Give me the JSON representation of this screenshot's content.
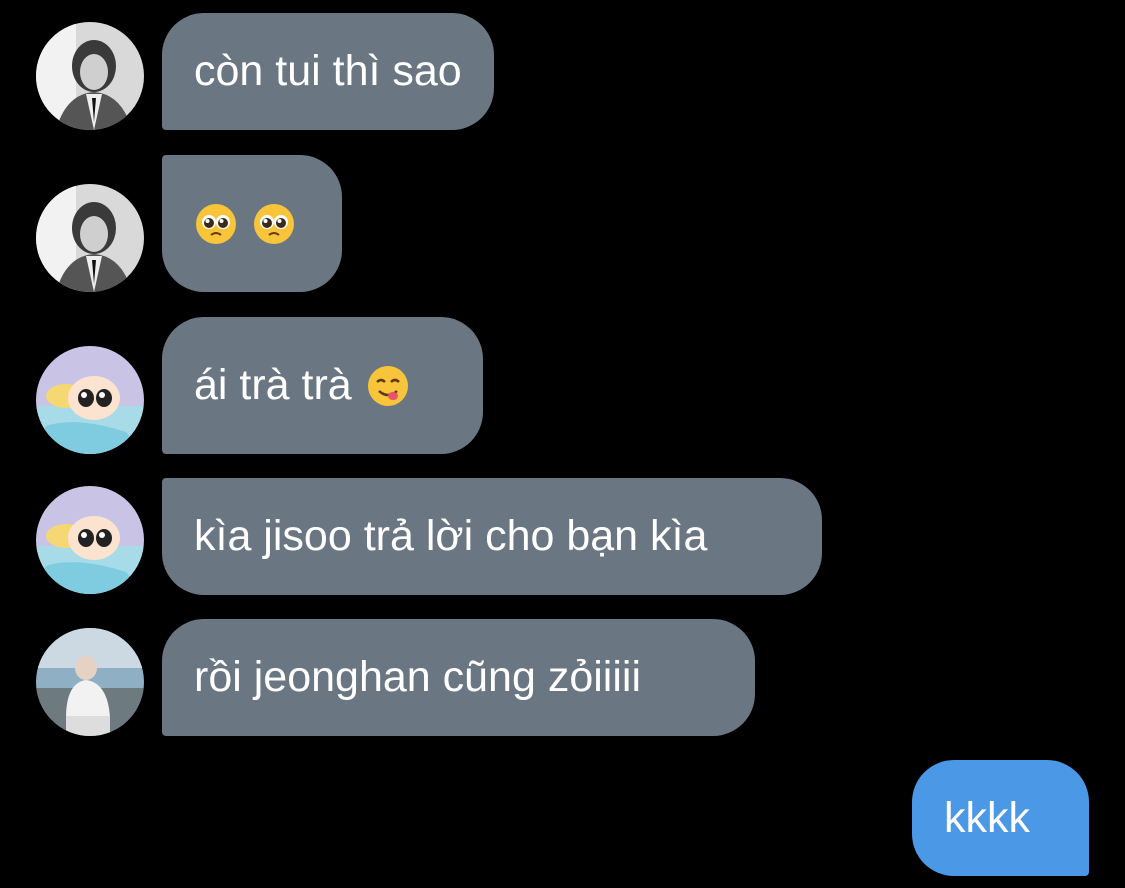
{
  "messages": [
    {
      "sender": "user-a",
      "text": "còn tui thì sao",
      "emojis": []
    },
    {
      "sender": "user-a",
      "text": "",
      "emojis": [
        "pleading-face",
        "pleading-face"
      ]
    },
    {
      "sender": "user-b",
      "text": "ái trà trà",
      "emojis": [
        "face-savoring-food"
      ]
    },
    {
      "sender": "user-b",
      "text": "kìa jisoo trả lời cho bạn kìa",
      "emojis": []
    },
    {
      "sender": "user-c",
      "text": "rồi jeonghan cũng zỏiiiii",
      "emojis": []
    },
    {
      "sender": "me",
      "text": "kkkk",
      "emojis": []
    }
  ],
  "colors": {
    "background": "#000000",
    "incoming_bubble": "#6b7683",
    "outgoing_bubble": "#4a98e6",
    "text": "#ffffff"
  }
}
